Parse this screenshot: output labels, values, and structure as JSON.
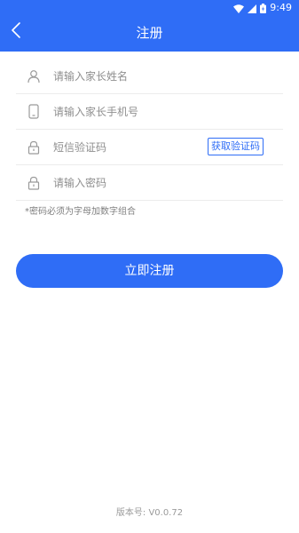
{
  "status_bar": {
    "time": "9:49",
    "wifi_icon": "wifi-icon",
    "signal_icon": "signal-icon",
    "battery_icon": "battery-icon"
  },
  "header": {
    "title": "注册",
    "back_icon": "chevron-left-icon",
    "background_color": "#2f6df6"
  },
  "form": {
    "parent_name": {
      "placeholder": "请输入家长姓名",
      "icon": "user-icon"
    },
    "parent_phone": {
      "placeholder": "请输入家长手机号",
      "icon": "phone-icon"
    },
    "sms_code": {
      "placeholder": "短信验证码",
      "icon": "lock-icon",
      "button_label": "获取验证码"
    },
    "password": {
      "placeholder": "请输入密码",
      "icon": "lock-icon"
    },
    "hint": "*密码必须为字母加数字组合"
  },
  "submit": {
    "label": "立即注册"
  },
  "footer": {
    "version": "版本号: V0.0.72"
  }
}
